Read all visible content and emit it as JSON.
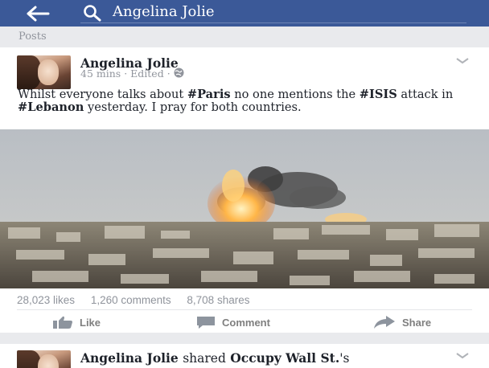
{
  "header": {
    "search_query": "Angelina Jolie",
    "bar_color": "#3b5998",
    "back_icon": "arrow-left-icon",
    "search_icon": "magnifier-icon"
  },
  "section": {
    "label": "Posts"
  },
  "post": {
    "author": "Angelina Jolie",
    "time": "45 mins",
    "sep": "·",
    "edited": "Edited",
    "privacy_icon": "globe-icon",
    "text": {
      "t1": "Whilst everyone talks about ",
      "tag1": "#Paris",
      "t2": " no one mentions the ",
      "tag2": "#ISIS",
      "t3": " attack in ",
      "tag3": "#Lebanon",
      "t4": " yesterday. I pray for both countries."
    },
    "photo_description_icon": "explosion-photo",
    "stats": {
      "likes": "28,023 likes",
      "comments": "1,260 comments",
      "shares": "8,708 shares"
    },
    "actions": {
      "like": "Like",
      "comment": "Comment",
      "share": "Share"
    }
  },
  "post2": {
    "author": "Angelina Jolie",
    "shared": "shared",
    "page": "Occupy Wall St.",
    "suffix": "'s"
  }
}
